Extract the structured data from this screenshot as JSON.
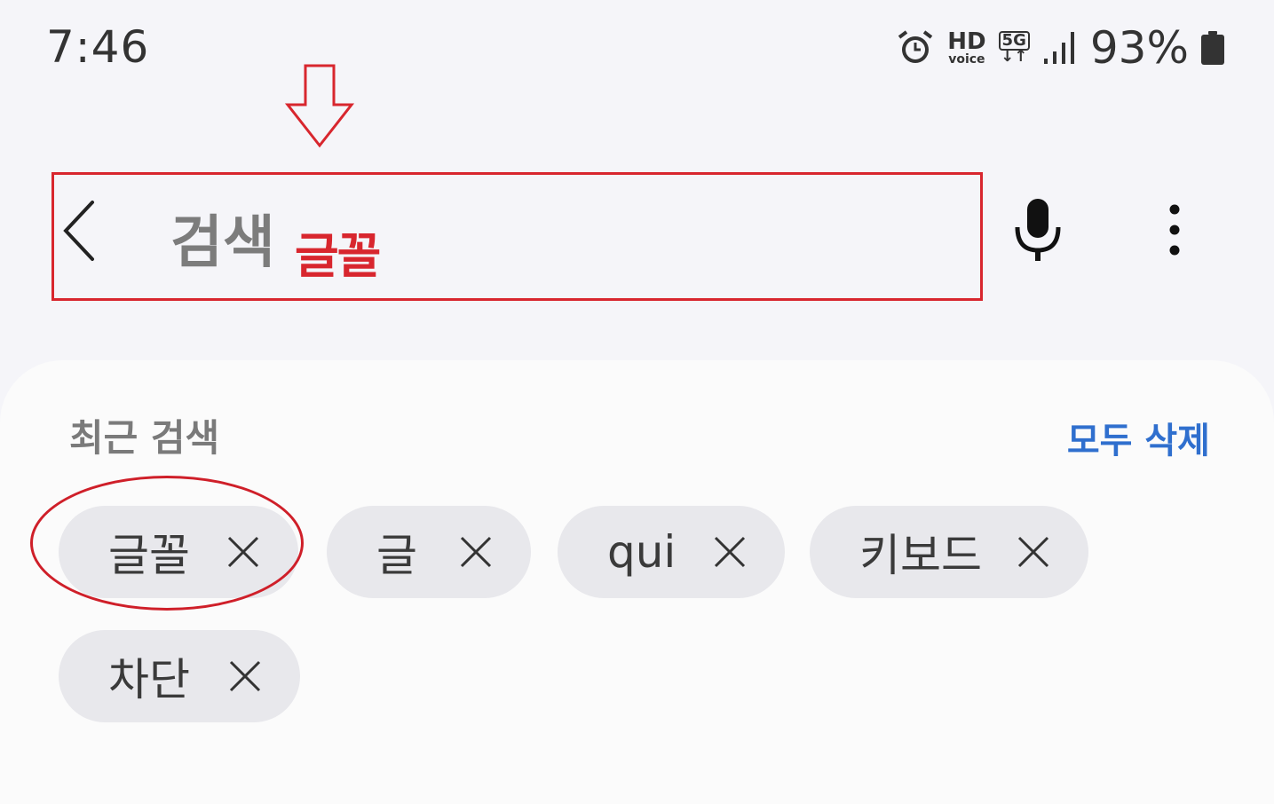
{
  "status_bar": {
    "time": "7:46",
    "hd_big": "HD",
    "hd_small": "voice",
    "network": "5G",
    "network_arrows": "↓↑",
    "battery": "93%"
  },
  "search": {
    "placeholder": "검색",
    "annotation_text": "글꼴"
  },
  "recent": {
    "title": "최근 검색",
    "clear_all": "모두 삭제",
    "chips": [
      {
        "label": "글꼴"
      },
      {
        "label": "글"
      },
      {
        "label": "qui"
      },
      {
        "label": "키보드"
      },
      {
        "label": "차단"
      }
    ]
  },
  "colors": {
    "annotation": "#d8262e",
    "link": "#2f6fce",
    "chip_bg": "#e8e8ec"
  }
}
